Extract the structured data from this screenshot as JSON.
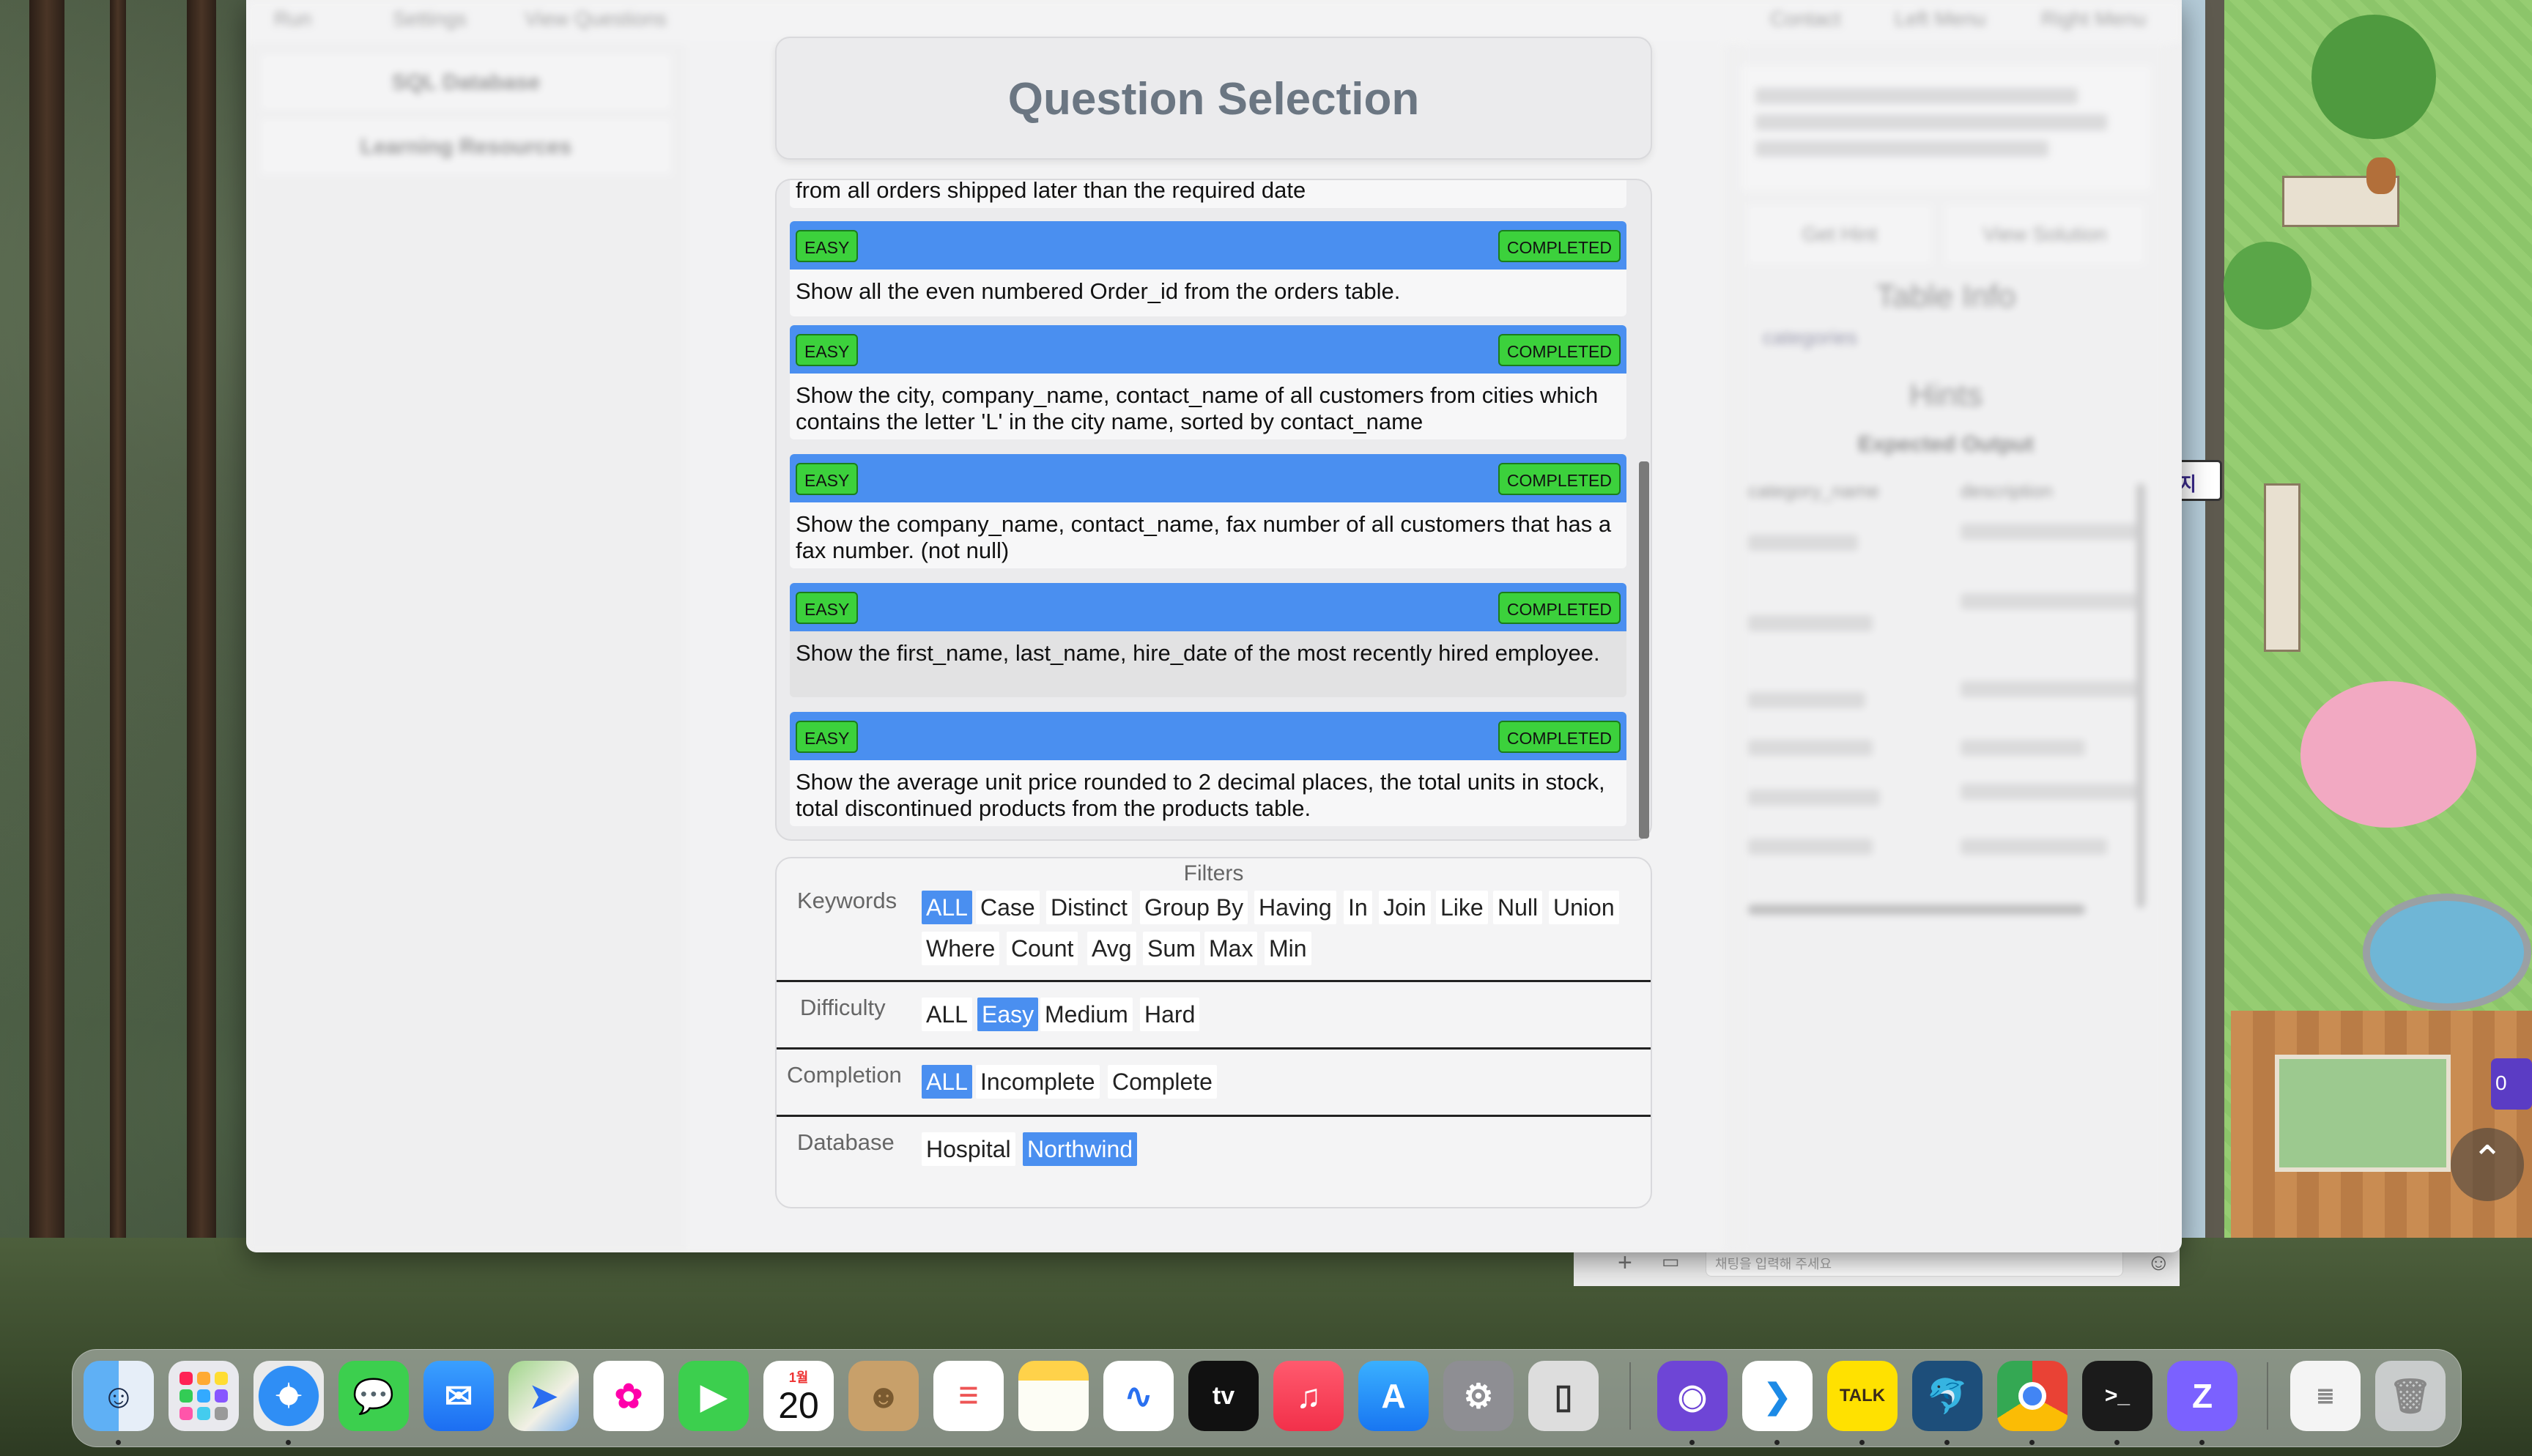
{
  "window": {
    "topbar_items": [
      "Run",
      "Settings",
      "View Questions",
      "Contact",
      "Left Menu",
      "Right Menu"
    ],
    "left_nav": [
      "SQL Database",
      "Learning Resources"
    ]
  },
  "modal": {
    "title": "Question Selection",
    "partial_question": "from all orders shipped later than the required date",
    "questions": [
      {
        "difficulty": "EASY",
        "status": "COMPLETED",
        "text": "Show all the even numbered Order_id from the orders table."
      },
      {
        "difficulty": "EASY",
        "status": "COMPLETED",
        "text": "Show the city, company_name, contact_name of all customers from cities which contains the letter 'L' in the city name, sorted by contact_name"
      },
      {
        "difficulty": "EASY",
        "status": "COMPLETED",
        "text": "Show the company_name, contact_name, fax number of all customers that has a fax number. (not null)"
      },
      {
        "difficulty": "EASY",
        "status": "COMPLETED",
        "text": "Show the first_name, last_name, hire_date of the most recently hired employee."
      },
      {
        "difficulty": "EASY",
        "status": "COMPLETED",
        "text": "Show the average unit price rounded to 2 decimal places, the total units in stock, total discontinued products from the products table."
      }
    ]
  },
  "filters": {
    "title": "Filters",
    "keywords": {
      "label": "Keywords",
      "options": [
        "ALL",
        "Case",
        "Distinct",
        "Group By",
        "Having",
        "In",
        "Join",
        "Like",
        "Null",
        "Union",
        "Where",
        "Count",
        "Avg",
        "Sum",
        "Max",
        "Min"
      ],
      "selected": "ALL"
    },
    "difficulty": {
      "label": "Difficulty",
      "options": [
        "ALL",
        "Easy",
        "Medium",
        "Hard"
      ],
      "selected": "Easy"
    },
    "completion": {
      "label": "Completion",
      "options": [
        "ALL",
        "Incomplete",
        "Complete"
      ],
      "selected": "ALL"
    },
    "database": {
      "label": "Database",
      "options": [
        "Hospital",
        "Northwind"
      ],
      "selected": "Northwind"
    }
  },
  "right_panel": {
    "table_info_title": "Table Info",
    "table_name": "categories",
    "hints_title": "Hints",
    "expected_output": "Expected Output",
    "columns": [
      "category_name",
      "description"
    ],
    "buttons": [
      "Get Hint",
      "View Solution"
    ]
  },
  "chat": {
    "placeholder": "채팅을 입력해 주세요"
  },
  "dock": {
    "apps": [
      "finder",
      "launchpad",
      "safari",
      "messages",
      "mail",
      "maps",
      "photos",
      "facetime",
      "calendar",
      "contacts",
      "reminders",
      "notes",
      "freeform",
      "apple-tv",
      "music",
      "app-store",
      "system-settings",
      "iphone-mirroring",
      "github-desktop",
      "vscode",
      "kakaotalk",
      "mysql-workbench",
      "chrome",
      "terminal",
      "zoom",
      "downloads",
      "trash"
    ],
    "calendar_month": "1월",
    "calendar_day": "20",
    "kakao_label": "TALK",
    "tv_label": "tv"
  },
  "colors": {
    "accent_blue": "#4a8ff0",
    "tag_green": "#3cd13c"
  }
}
